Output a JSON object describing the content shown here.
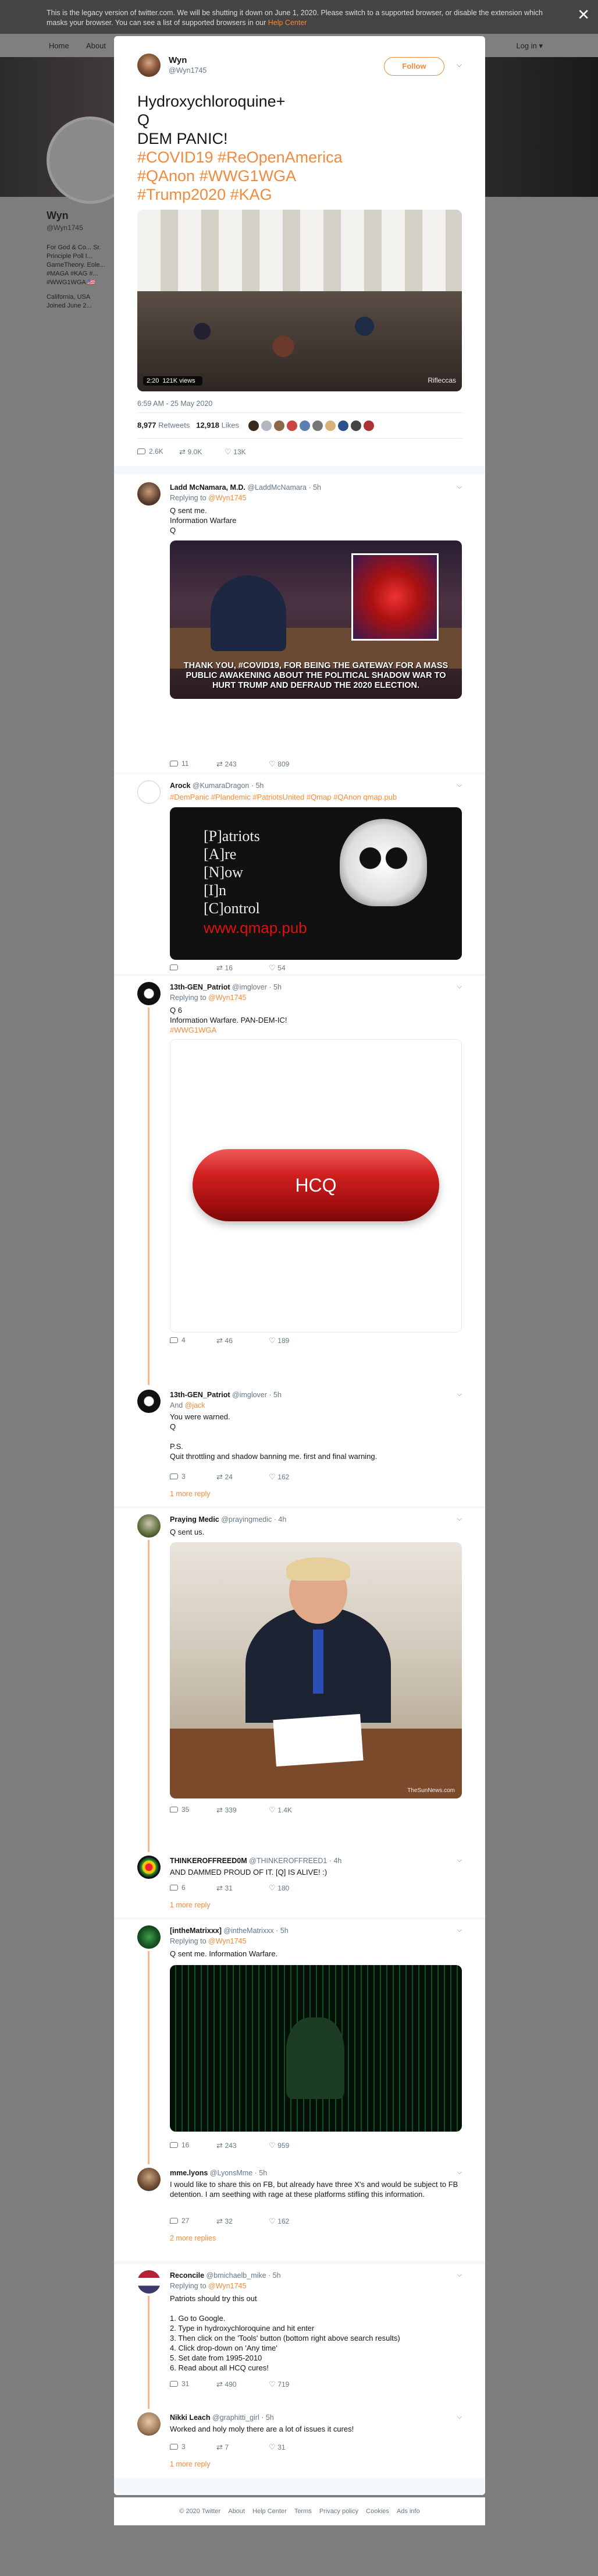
{
  "legacy_notice": {
    "text": "This is the legacy version of twitter.com. We will be shutting it down on June 1, 2020. Please switch to a supported browser, or disable the extension which masks your browser. You can see a list of supported browsers in our ",
    "link": "Help Center",
    "close_icon": "✕"
  },
  "topnav": {
    "home": "Home",
    "about": "About",
    "language": "Log in ▾"
  },
  "profile_bg": {
    "name": "Wyn",
    "handle": "@Wyn1745",
    "bio": "For God & Co... Sr. Principle Poll I... GameTheory. Eole... #MAGA #KAG #... #WWG1WGA 🇺🇸",
    "location": "California, USA",
    "joined": "Joined June 2..."
  },
  "main_tweet": {
    "name": "Wyn",
    "handle": "@Wyn1745",
    "follow_label": "Follow",
    "lines": [
      {
        "text": "Hydroxychloroquine+",
        "hashtag": false
      },
      {
        "text": "Q",
        "hashtag": false
      },
      {
        "text": "DEM PANIC!",
        "hashtag": false
      },
      {
        "text": "#COVID19 #ReOpenAmerica",
        "hashtag": true
      },
      {
        "text": "#QAnon #WWG1WGA",
        "hashtag": true
      },
      {
        "text": "#Trump2020 #KAG",
        "hashtag": true
      }
    ],
    "video_duration": "2:20",
    "video_views": "121K views",
    "video_watermark": "Rifleccas",
    "timestamp": "6:59 AM - 25 May 2020",
    "retweets_count": "8,977",
    "retweets_label": "Retweets",
    "likes_count": "12,918",
    "likes_label": "Likes",
    "reply_count": "2.6K",
    "retweet_action_count": "9.0K",
    "like_action_count": "13K"
  },
  "replies": [
    {
      "name": "Ladd McNamara, M.D.",
      "handle": "@LaddMcNamara · 5h",
      "replying_label": "Replying to",
      "replying_to": "@Wyn1745",
      "lines": [
        "Q sent me.",
        "Information Warfare",
        "Q"
      ],
      "image_caption": "THANK YOU, #COVID19, FOR BEING THE GATEWAY FOR A MASS PUBLIC AWAKENING ABOUT THE POLITICAL SHADOW WAR TO HURT TRUMP AND DEFRAUD THE 2020 ELECTION.",
      "replies": "11",
      "retweets": "243",
      "likes": "809"
    },
    {
      "name": "Arock",
      "handle": "@KumaraDragon · 5h",
      "text": "#DemPanic #Plandemic #PatriotsUnited #Qmap #QAnon qmap.pub",
      "image_lines": [
        "[P]atriots",
        "[A]re",
        "[N]ow",
        "[I]n",
        "[C]ontrol"
      ],
      "image_url": "www.qmap.pub",
      "replies": "",
      "retweets": "16",
      "likes": "54"
    },
    {
      "name": "13th-GEN_Patriot",
      "handle": "@imglover · 5h",
      "replying_label": "Replying to",
      "replying_to": "@Wyn1745",
      "lines": [
        "Q 6",
        "Information Warfare. PAN-DEM-IC!"
      ],
      "hashtag": "#WWG1WGA",
      "pill_text": "HCQ",
      "replies": "4",
      "retweets": "46",
      "likes": "189"
    },
    {
      "name": "13th-GEN_Patriot",
      "handle": "@imglover · 5h",
      "and_label": "And",
      "and_handle": "@jack",
      "lines": [
        "You were warned.",
        "Q",
        "",
        "P.S.",
        "Quit throttling and shadow banning me. first and final warning."
      ],
      "replies": "3",
      "retweets": "24",
      "likes": "162",
      "more": "1 more reply"
    },
    {
      "name": "Praying Medic",
      "handle": "@prayingmedic · 4h",
      "text": "Q sent us.",
      "watermark": "TheSunNews.com",
      "replies": "35",
      "retweets": "339",
      "likes": "1.4K"
    },
    {
      "name": "THINKEROFFREED0M",
      "handle": "@THINKEROFFREED1 · 4h",
      "text": "AND DAMMED PROUD OF IT. [Q] IS ALIVE! :)",
      "replies": "6",
      "retweets": "31",
      "likes": "180",
      "more": "1 more reply"
    },
    {
      "name": "[intheMatrixxx]",
      "handle": "@intheMatrixxx · 5h",
      "replying_label": "Replying to",
      "replying_to": "@Wyn1745",
      "text": "Q sent me. Information Warfare.",
      "replies": "16",
      "retweets": "243",
      "likes": "959"
    },
    {
      "name": "mme.lyons",
      "handle": "@LyonsMme · 5h",
      "text": "I would like to share this on FB, but already have three X's and would be subject to FB detention. I am seething with rage at these platforms stifling this information.",
      "replies": "27",
      "retweets": "32",
      "likes": "162",
      "more": "2 more replies"
    },
    {
      "name": "Reconcile",
      "handle": "@bmichaelb_mike · 5h",
      "replying_label": "Replying to",
      "replying_to": "@Wyn1745",
      "lines": [
        "Patriots should try this out",
        "",
        "1. Go to Google.",
        "2. Type in hydroxychloroquine and hit enter",
        "3. Then click on the 'Tools' button (bottom right above search results)",
        "4. Click drop-down on 'Any time'",
        "5. Set date from 1995-2010",
        "6. Read about all HCQ cures!"
      ],
      "replies": "31",
      "retweets": "490",
      "likes": "719"
    },
    {
      "name": "Nikki Leach",
      "handle": "@graphitti_girl · 5h",
      "text": "Worked and holy moly there are a lot of issues it cures!",
      "replies": "3",
      "retweets": "7",
      "likes": "31",
      "more": "1 more reply"
    }
  ],
  "footer": [
    "© 2020 Twitter",
    "About",
    "Help Center",
    "Terms",
    "Privacy policy",
    "Cookies",
    "Ads info"
  ]
}
